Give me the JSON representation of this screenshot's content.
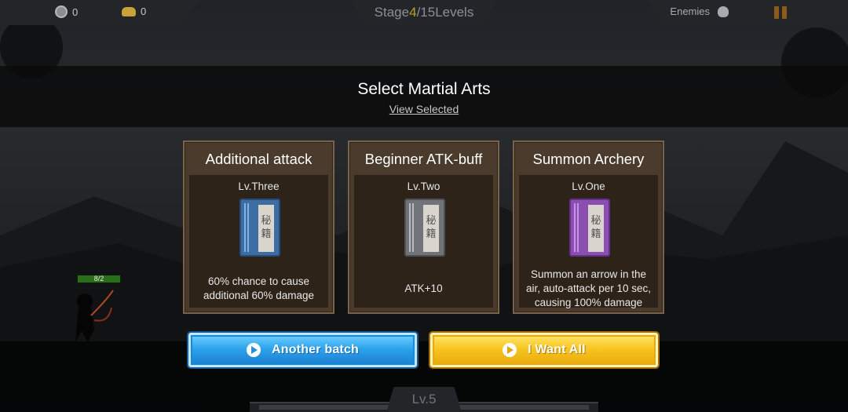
{
  "hud": {
    "coins": "0",
    "ingots": "0",
    "stage_prefix": "Stage ",
    "stage_current": "4",
    "stage_suffix": "/15Levels",
    "enemies_label": "Enemies"
  },
  "dialog": {
    "title": "Select Martial Arts",
    "view_selected": "View Selected"
  },
  "cards": [
    {
      "title": "Additional attack",
      "level": "Lv.Three",
      "book_color": "#3d6ea3",
      "book_chars": [
        "秘",
        "籍"
      ],
      "description": "60% chance to cause additional 60% damage"
    },
    {
      "title": "Beginner ATK-buff",
      "level": "Lv.Two",
      "book_color": "#707479",
      "book_chars": [
        "秘",
        "籍"
      ],
      "description": "ATK+10"
    },
    {
      "title": "Summon Archery",
      "level": "Lv.One",
      "book_color": "#8a4fb0",
      "book_chars": [
        "秘",
        "籍"
      ],
      "description": "Summon an arrow in the air, auto-attack per 10 sec, causing 100% damage"
    }
  ],
  "buttons": {
    "another_batch": "Another batch",
    "want_all": "I Want All"
  },
  "player": {
    "hp_text": "8/2"
  },
  "footer": {
    "level": "Lv.5"
  },
  "colors": {
    "accent_stage": "#c49a2a",
    "button_blue": "#2ea3ec",
    "button_yellow": "#f7c623",
    "card_bg": "#4a3b2d"
  }
}
